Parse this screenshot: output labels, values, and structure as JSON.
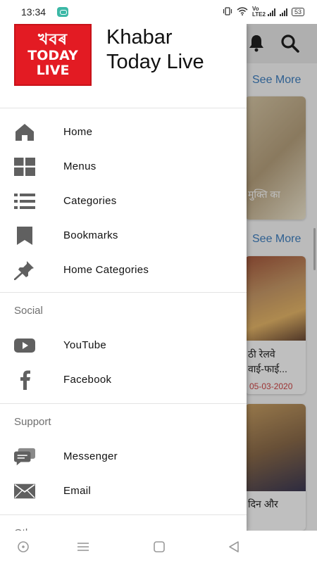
{
  "status_bar": {
    "time": "13:34",
    "lte_label": "Vo LTE2",
    "battery": "53"
  },
  "app": {
    "logo": {
      "line1": "খবৰ",
      "line2": "TODAY",
      "line3": "LIVE"
    },
    "title_line1": "Khabar",
    "title_line2": "Today Live"
  },
  "drawer": {
    "main_items": [
      {
        "label": "Home",
        "icon": "home-icon"
      },
      {
        "label": "Menus",
        "icon": "grid-icon"
      },
      {
        "label": "Categories",
        "icon": "list-icon"
      },
      {
        "label": "Bookmarks",
        "icon": "bookmark-icon"
      },
      {
        "label": "Home Categories",
        "icon": "pin-icon"
      }
    ],
    "social_header": "Social",
    "social_items": [
      {
        "label": "YouTube",
        "icon": "youtube-icon"
      },
      {
        "label": "Facebook",
        "icon": "facebook-icon"
      }
    ],
    "support_header": "Support",
    "support_items": [
      {
        "label": "Messenger",
        "icon": "messenger-icon"
      },
      {
        "label": "Email",
        "icon": "email-icon"
      }
    ],
    "others_header": "Others"
  },
  "background": {
    "see_more_1": "See More",
    "see_more_2": "See More",
    "card1_text": "मुक्ति का",
    "card2_text_line1": "ठी रेलवे",
    "card2_text_line2": "वाई-फाई...",
    "card2_date": "05-03-2020",
    "card3_text": "दिन और"
  },
  "colors": {
    "logo_red": "#e31b23",
    "link_blue": "#3e7fc1",
    "icon_gray": "#606060",
    "date_red": "#d04545"
  }
}
